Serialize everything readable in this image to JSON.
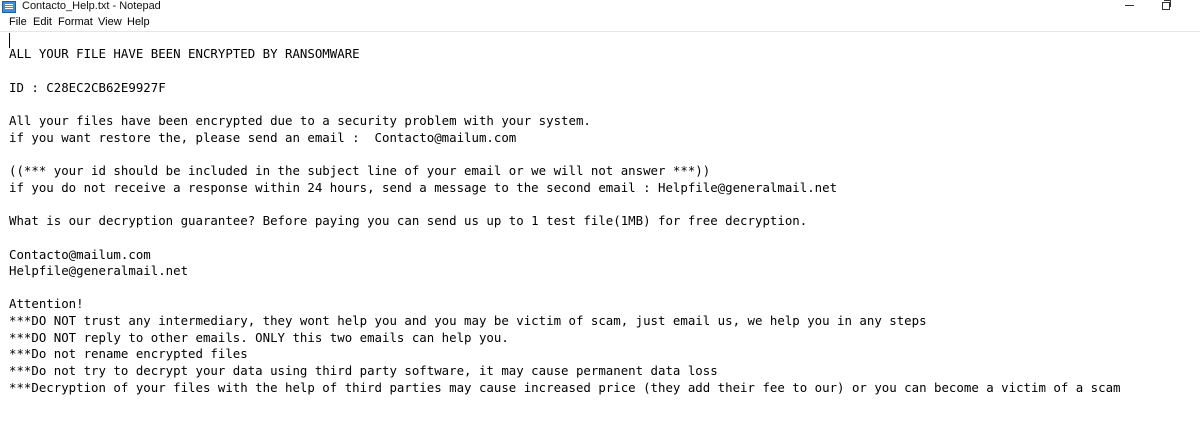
{
  "window": {
    "title": "Contacto_Help.txt - Notepad",
    "icon": "notepad-icon"
  },
  "menu": {
    "file": "File",
    "edit": "Edit",
    "format": "Format",
    "view": "View",
    "help": "Help"
  },
  "document": {
    "lines": [
      "ALL YOUR FILE HAVE BEEN ENCRYPTED BY RANSOMWARE",
      "ID : C28EC2CB62E9927F",
      "All your files have been encrypted due to a security problem with your system.",
      "if you want restore the, please send an email :  Contacto@mailum.com",
      "((*** your id should be included in the subject line of your email or we will not answer ***))",
      "if you do not receive a response within 24 hours, send a message to the second email : Helpfile@generalmail.net",
      "What is our decryption guarantee? Before paying you can send us up to 1 test file(1MB) for free decryption.",
      "Contacto@mailum.com",
      "Helpfile@generalmail.net",
      "Attention!",
      "***DO NOT trust any intermediary, they wont help you and you may be victim of scam, just email us, we help you in any steps",
      "***DO NOT reply to other emails. ONLY this two emails can help you.",
      "***Do not rename encrypted files",
      "***Do not try to decrypt your data using third party software, it may cause permanent data loss",
      "***Decryption of your files with the help of third parties may cause increased price (they add their fee to our) or you can become a victim of a scam"
    ]
  }
}
